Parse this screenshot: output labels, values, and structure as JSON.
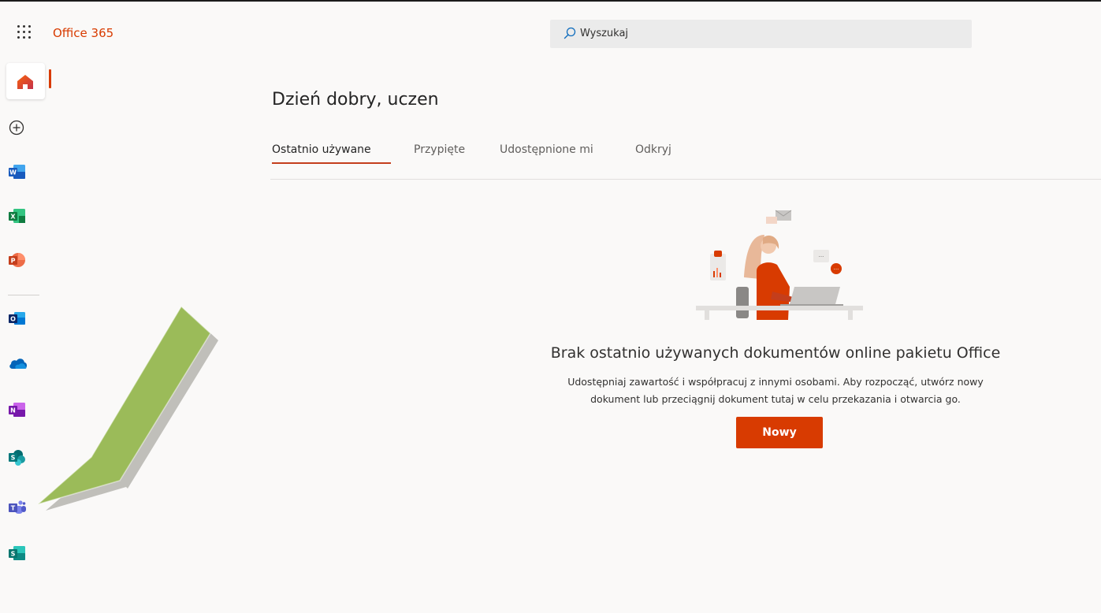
{
  "header": {
    "app_name": "Office 365",
    "search_placeholder": "Wyszukaj"
  },
  "rail": {
    "items": [
      {
        "name": "home-icon",
        "active": true
      },
      {
        "name": "create-icon"
      },
      {
        "name": "word-icon",
        "letter": "W"
      },
      {
        "name": "excel-icon",
        "letter": "X"
      },
      {
        "name": "powerpoint-icon",
        "letter": "P"
      },
      {
        "name": "outlook-icon",
        "letter": "O"
      },
      {
        "name": "onedrive-icon"
      },
      {
        "name": "onenote-icon",
        "letter": "N"
      },
      {
        "name": "sharepoint-icon",
        "letter": "S"
      },
      {
        "name": "teams-icon",
        "letter": "T"
      },
      {
        "name": "sway-icon",
        "letter": "S"
      }
    ],
    "accent_color": "#d83b01"
  },
  "main": {
    "greeting": "Dzień dobry, uczen",
    "tabs": [
      {
        "label": "Ostatnio używane",
        "active": true
      },
      {
        "label": "Przypięte"
      },
      {
        "label": "Udostępnione mi"
      },
      {
        "label": "Odkryj"
      }
    ],
    "empty_state": {
      "title": "Brak ostatnio używanych dokumentów online pakietu Office",
      "description_line1": "Udostępniaj zawartość i współpracuj z innymi osobami. Aby rozpocząć, utwórz nowy",
      "description_line2": "dokument lub przeciągnij dokument tutaj w celu przekazania i otwarcia go.",
      "button_label": "Nowy"
    }
  },
  "colors": {
    "brand": "#d83b01",
    "annotation_arrow": "#9bbb59"
  }
}
